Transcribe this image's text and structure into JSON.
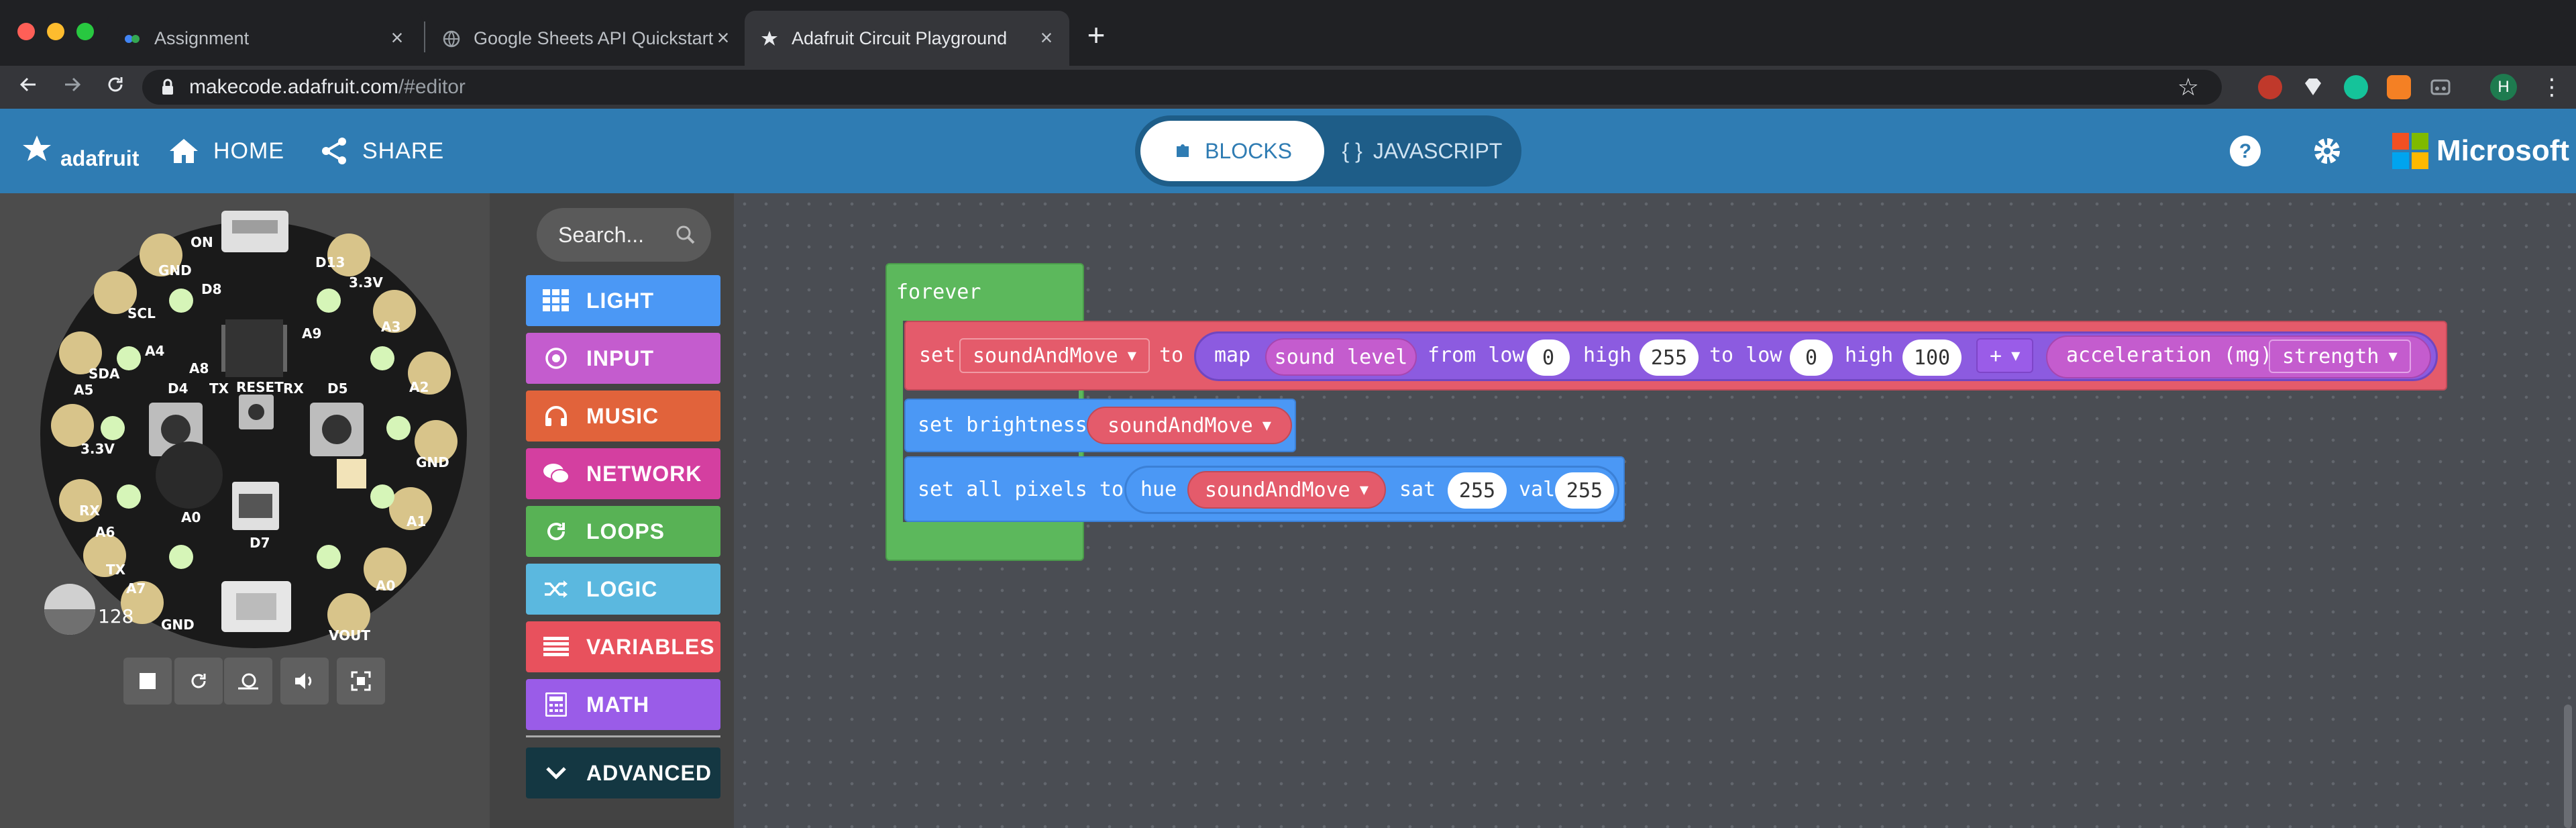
{
  "browser": {
    "tabs": [
      {
        "title": "Assignment"
      },
      {
        "title": "Google Sheets API Quickstart"
      },
      {
        "title": "Adafruit Circuit Playground Exp"
      }
    ],
    "close_glyph": "×",
    "new_tab_glyph": "+",
    "url_host": "makecode.adafruit.com",
    "url_path": "/#editor",
    "profile_initial": "H"
  },
  "header": {
    "brand": "adafruit",
    "home_label": "HOME",
    "share_label": "SHARE",
    "blocks_label": "BLOCKS",
    "javascript_label": "JAVASCRIPT",
    "microsoft_label": "Microsoft"
  },
  "simulator": {
    "volume_value": "128",
    "board_labels": {
      "gnd_top": "GND",
      "d8": "D8",
      "d13": "D13",
      "v33_top": "3.3V",
      "a3": "A3",
      "a2": "A2",
      "scl": "SCL",
      "a4": "A4",
      "sda": "SDA",
      "a5": "A5",
      "v33_left": "3.3V",
      "rx": "RX",
      "a6": "A6",
      "tx": "TX",
      "a7": "A7",
      "gnd_left": "GND",
      "gnd_right": "GND",
      "a1": "A1",
      "a0_right": "A0",
      "vout": "VOUT",
      "gnd_bottom": "GND",
      "a9": "A9",
      "a8": "A8",
      "d4": "D4",
      "d5": "D5",
      "tx_mid": "TX",
      "reset": "RESET",
      "rx_mid": "RX",
      "a0_mid": "A0",
      "d7": "D7",
      "on": "ON"
    }
  },
  "toolbox": {
    "search_placeholder": "Search...",
    "categories": [
      {
        "label": "LIGHT",
        "color": "#4b98f5",
        "icon": "grid-icon"
      },
      {
        "label": "INPUT",
        "color": "#c45cce",
        "icon": "target-icon"
      },
      {
        "label": "MUSIC",
        "color": "#e1633b",
        "icon": "headphones-icon"
      },
      {
        "label": "NETWORK",
        "color": "#d43fa0",
        "icon": "chat-icon"
      },
      {
        "label": "LOOPS",
        "color": "#58b255",
        "icon": "refresh-icon"
      },
      {
        "label": "LOGIC",
        "color": "#5bb8df",
        "icon": "shuffle-icon"
      },
      {
        "label": "VARIABLES",
        "color": "#e8515d",
        "icon": "list-icon"
      },
      {
        "label": "MATH",
        "color": "#9a5ce8",
        "icon": "calculator-icon"
      },
      {
        "label": "ADVANCED",
        "color": "#143742",
        "icon": "chevron-down-icon"
      }
    ]
  },
  "workspace": {
    "forever_label": "forever",
    "set1": {
      "set": "set",
      "var": "soundAndMove",
      "to": "to",
      "map": "map",
      "sound_level": "sound level",
      "from_low": "from low",
      "from_low_val": "0",
      "high": "high",
      "high_val": "255",
      "to_low": "to low",
      "to_low_val": "0",
      "high2": "high",
      "high2_val": "100",
      "op": "+",
      "accel": "acceleration (mg)",
      "strength": "strength"
    },
    "set2": {
      "label": "set brightness",
      "var": "soundAndMove"
    },
    "set3": {
      "label": "set all pixels to",
      "hue": "hue",
      "var": "soundAndMove",
      "sat": "sat",
      "sat_val": "255",
      "val": "val",
      "val_val": "255"
    }
  }
}
